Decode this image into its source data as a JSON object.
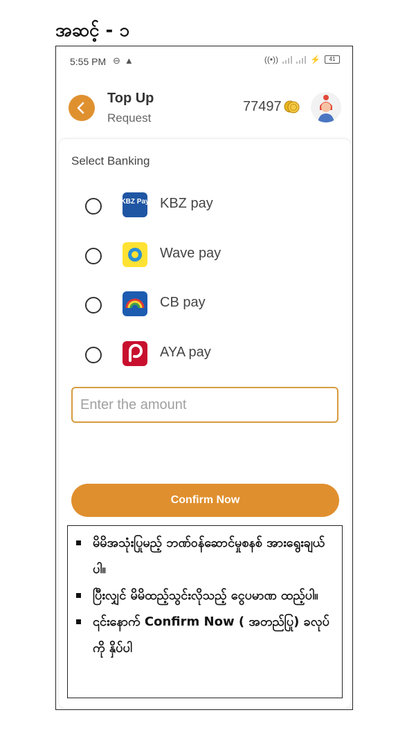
{
  "step_title": "အဆင့် - ၁",
  "status_bar": {
    "time": "5:55 PM",
    "battery": "41"
  },
  "header": {
    "title": "Top Up",
    "subtitle": "Request",
    "coins": "77497"
  },
  "select_label": "Select Banking",
  "banks": [
    {
      "name": "KBZ pay",
      "logo_text": "KBZ Pay",
      "color": "#1f56a3"
    },
    {
      "name": "Wave pay",
      "color": "#ffe233"
    },
    {
      "name": "CB pay",
      "color": "#1d5cb0"
    },
    {
      "name": "AYA pay",
      "color": "#c8102e"
    }
  ],
  "amount": {
    "placeholder": "Enter the amount",
    "value": ""
  },
  "confirm_label": "Confirm Now",
  "instructions": [
    "မိမိအသုံးပြုမည့် ဘဏ်ဝန်ဆောင်မှုစနစ် အားရွေးချယ်ပါ။",
    "ပြီးလျှင် မိမိထည့်သွင်းလိုသည့် ငွေပမာဏ ထည့်ပါ။",
    "၎င်းနောက် Confirm Now ( အတည်ပြု) ခလုပ်ကို နှိပ်ပါ"
  ],
  "colors": {
    "accent": "#e08f2e",
    "input_border": "#d79b3d"
  }
}
